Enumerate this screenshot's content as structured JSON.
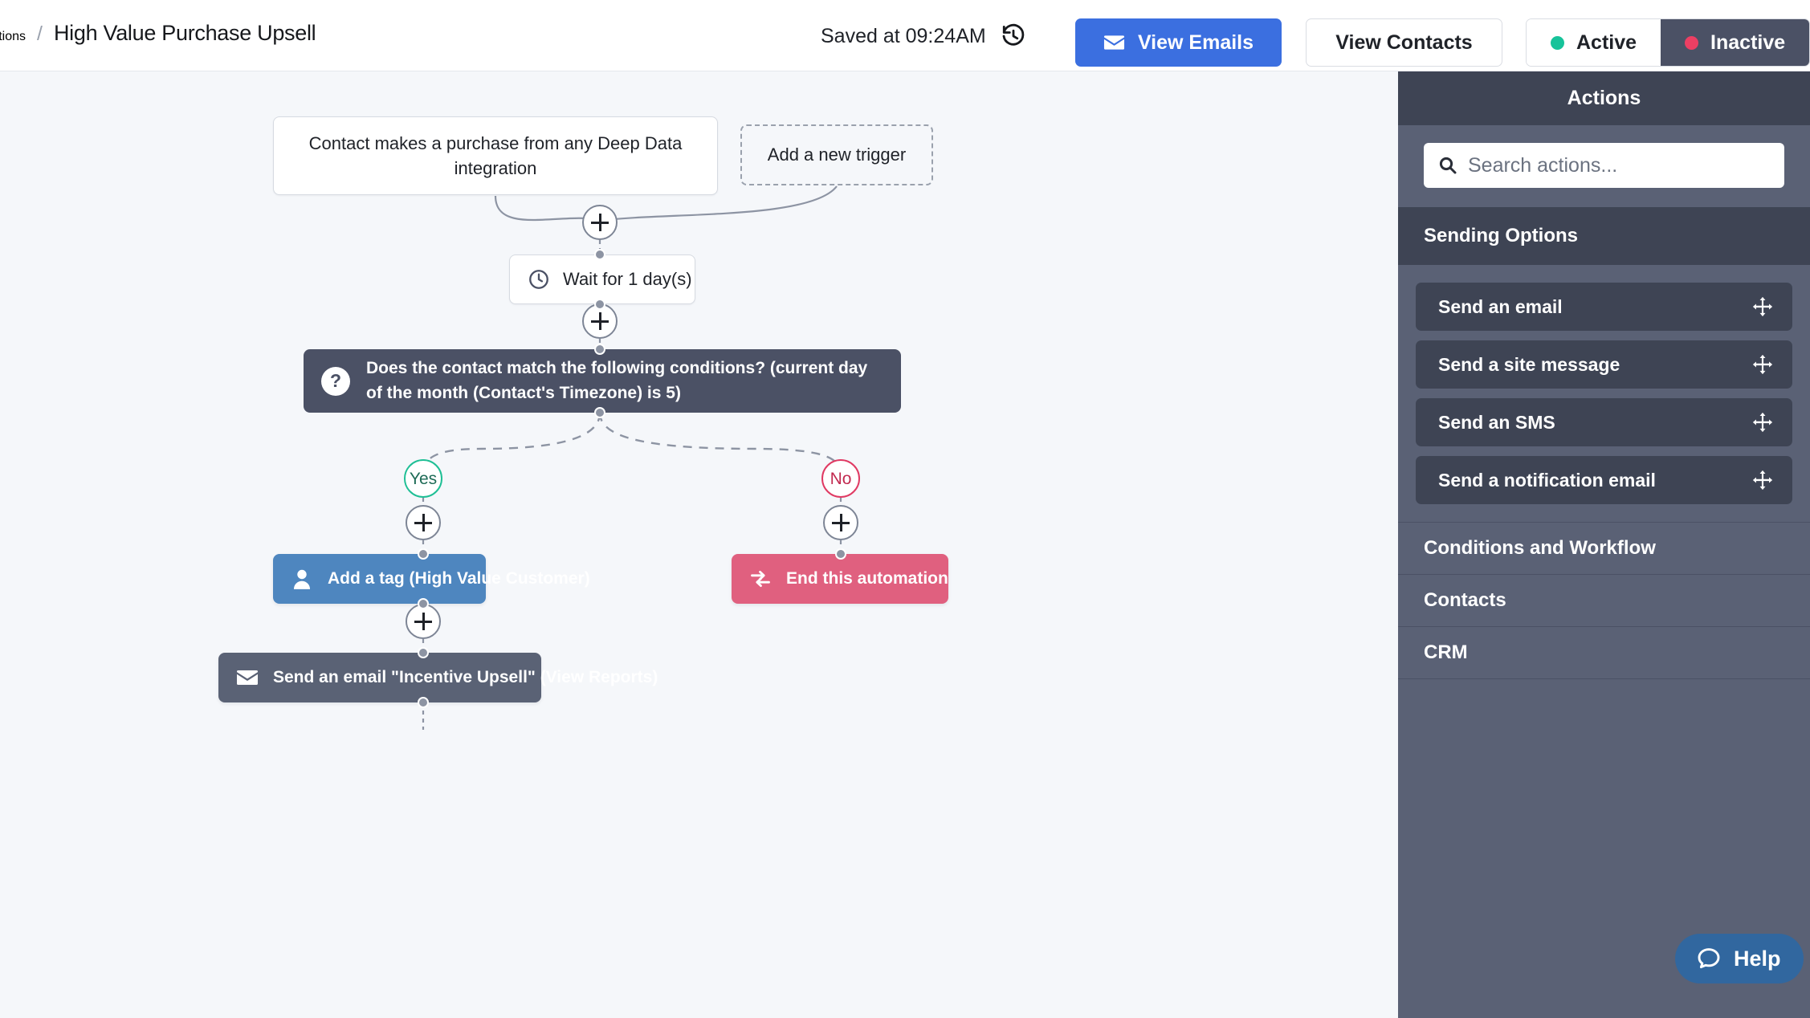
{
  "header": {
    "breadcrumb": {
      "parent": "mations",
      "separator": "/",
      "current": "High Value Purchase Upsell"
    },
    "saved_status": "Saved at 09:24AM",
    "history_icon": "history-clock-rewind-icon",
    "view_emails_label": "View Emails",
    "view_emails_icon": "envelope-icon",
    "view_contacts_label": "View Contacts",
    "status_toggle": {
      "active_label": "Active",
      "inactive_label": "Inactive",
      "selected": "Inactive",
      "active_dot_color": "#17c39a",
      "inactive_dot_color": "#ec3f63"
    }
  },
  "canvas": {
    "trigger": {
      "label": "Contact makes a purchase from any Deep Data integration"
    },
    "add_trigger": {
      "label": "Add a new trigger"
    },
    "wait": {
      "label": "Wait for 1 day(s)",
      "icon": "clock-icon"
    },
    "condition": {
      "label": "Does the contact match the following conditions? (current day of the month (Contact's Timezone) is 5)",
      "icon": "question-mark-icon",
      "color": "#4b5165"
    },
    "branch_yes": {
      "label": "Yes",
      "color": "#1fbf95"
    },
    "branch_no": {
      "label": "No",
      "color": "#e03a63"
    },
    "add_tag": {
      "label": "Add a tag (High Value Customer)",
      "icon": "user-icon",
      "color": "#4e86bf"
    },
    "end_automation": {
      "label": "End this automation",
      "icon": "exchange-arrows-icon",
      "color": "#e0607f"
    },
    "send_email": {
      "label": "Send an email \"Incentive Upsell\" (View Reports)",
      "icon": "envelope-icon",
      "color": "#5a6275"
    },
    "plus_node_label": "+"
  },
  "panel": {
    "title": "Actions",
    "search": {
      "placeholder": "Search actions...",
      "value": "",
      "icon": "search-icon"
    },
    "sections": [
      {
        "title": "Sending Options",
        "expanded": true,
        "items": [
          {
            "label": "Send an email",
            "handle_icon": "move-handle-icon"
          },
          {
            "label": "Send a site message",
            "handle_icon": "move-handle-icon"
          },
          {
            "label": "Send an SMS",
            "handle_icon": "move-handle-icon"
          },
          {
            "label": "Send a notification email",
            "handle_icon": "move-handle-icon"
          }
        ]
      },
      {
        "title": "Conditions and Workflow",
        "expanded": false,
        "items": []
      },
      {
        "title": "Contacts",
        "expanded": false,
        "items": []
      },
      {
        "title": "CRM",
        "expanded": false,
        "items": []
      }
    ]
  },
  "help": {
    "label": "Help",
    "icon": "chat-bubble-icon",
    "color": "#31679f"
  }
}
